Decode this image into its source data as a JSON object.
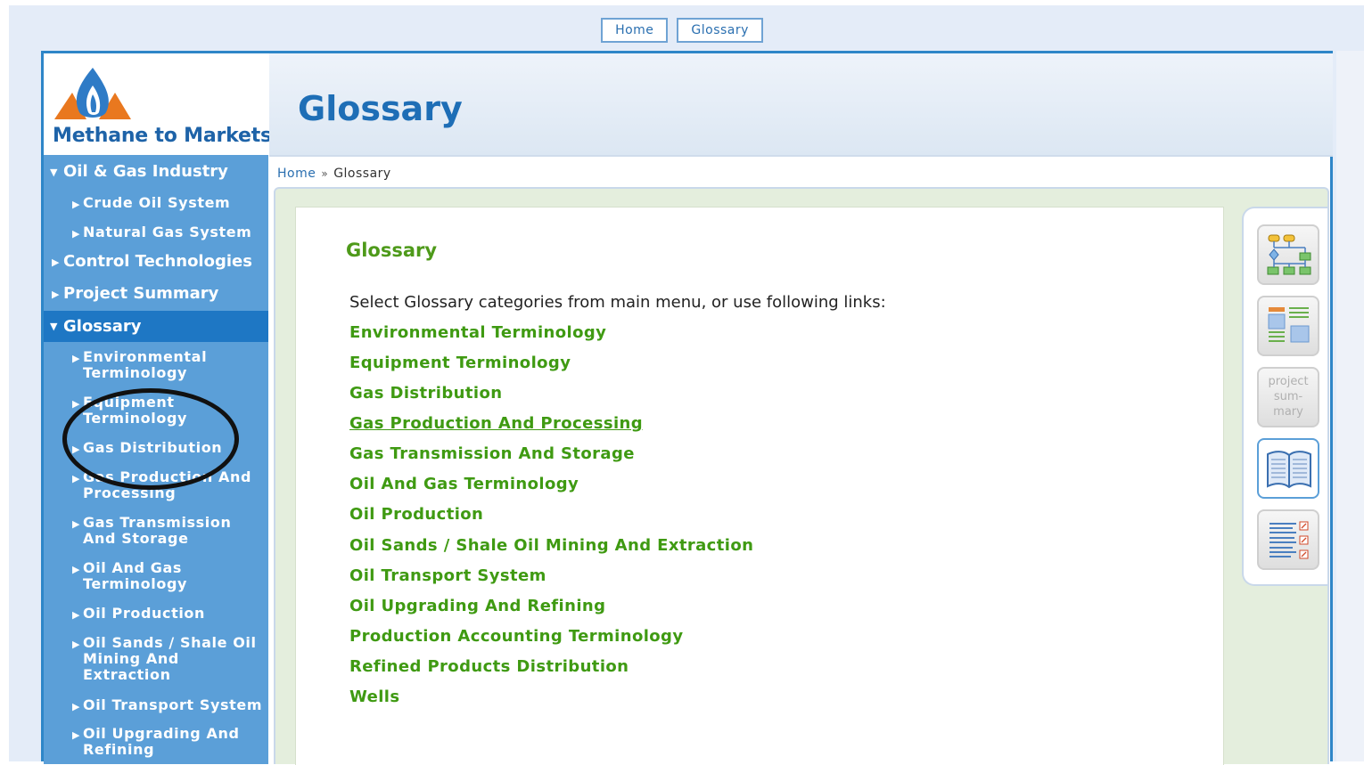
{
  "top_nav": {
    "home": "Home",
    "glossary": "Glossary"
  },
  "logo": {
    "text": "Methane to Markets"
  },
  "header": {
    "title": "Glossary"
  },
  "breadcrumb": {
    "home": "Home",
    "separator": "»",
    "current": "Glossary"
  },
  "sidebar": {
    "items": [
      {
        "label": "Oil & Gas Industry"
      },
      {
        "label": "Crude Oil System"
      },
      {
        "label": "Natural Gas System"
      },
      {
        "label": "Control Technologies"
      },
      {
        "label": "Project Summary"
      },
      {
        "label": "Glossary"
      },
      {
        "label": "Environmental Terminology"
      },
      {
        "label": "Equipment Terminology"
      },
      {
        "label": "Gas Distribution"
      },
      {
        "label": "Gas Production And Processing"
      },
      {
        "label": "Gas Transmission And Storage"
      },
      {
        "label": "Oil And Gas Terminology"
      },
      {
        "label": "Oil Production"
      },
      {
        "label": "Oil Sands / Shale Oil Mining And Extraction"
      },
      {
        "label": "Oil Transport System"
      },
      {
        "label": "Oil Upgrading And Refining"
      }
    ]
  },
  "content": {
    "heading": "Glossary",
    "intro": "Select Glossary categories from main menu, or use following links:",
    "links": [
      "Environmental Terminology",
      "Equipment Terminology",
      "Gas Distribution",
      "Gas Production And Processing",
      "Gas Transmission And Storage",
      "Oil And Gas Terminology",
      "Oil Production",
      "Oil Sands / Shale Oil Mining And Extraction",
      "Oil Transport System",
      "Oil Upgrading And Refining",
      "Production Accounting Terminology",
      "Refined Products Distribution",
      "Wells"
    ]
  },
  "rail": {
    "project_summary": "project sum- mary",
    "icons": [
      "flowchart-icon",
      "layout-icon",
      "project-summary-icon",
      "book-icon",
      "list-links-icon"
    ]
  },
  "colors": {
    "accent_blue": "#1e6eb6",
    "sidebar_bg": "#5b9fd8",
    "sidebar_active": "#1e77c4",
    "link_green": "#3f9a12"
  }
}
